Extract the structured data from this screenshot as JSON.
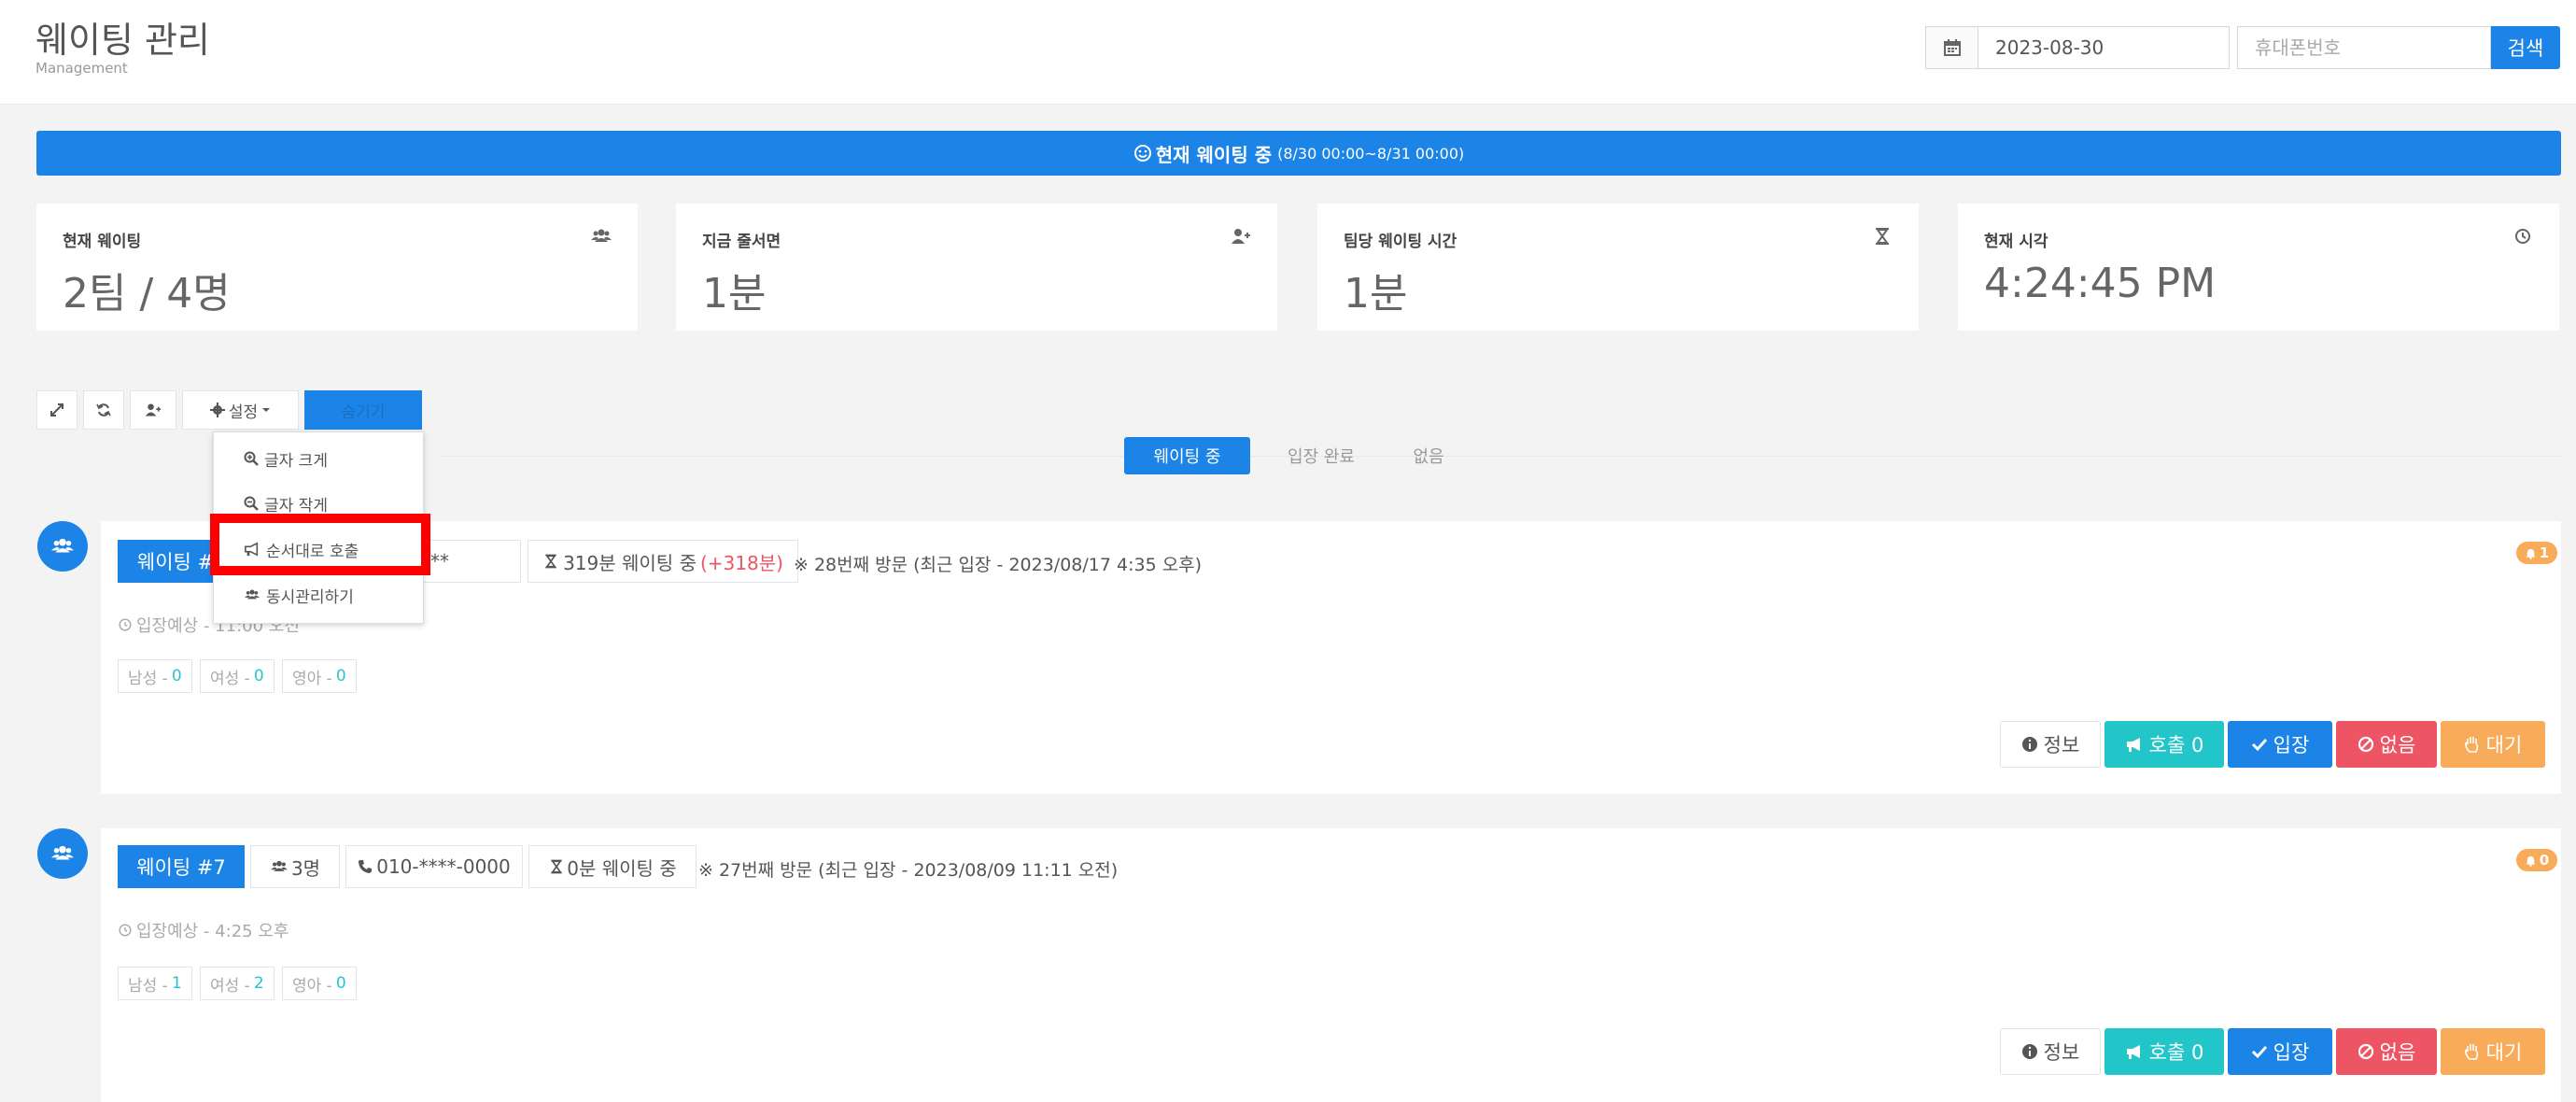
{
  "header": {
    "title": "웨이팅 관리",
    "subtitle": "Management",
    "date": "2023-08-30",
    "phone_placeholder": "휴대폰번호",
    "search_label": "검색"
  },
  "banner": {
    "text": "현재 웨이팅 중",
    "range": "(8/30 00:00~8/31 00:00)"
  },
  "stats": [
    {
      "label": "현재 웨이팅",
      "value": "2팀 / 4명",
      "icon": "users-icon"
    },
    {
      "label": "지금 줄서면",
      "value": "1분",
      "icon": "user-plus-icon"
    },
    {
      "label": "팀당 웨이팅 시간",
      "value": "1분",
      "icon": "hourglass-icon"
    },
    {
      "label": "현재 시각",
      "value": "4:24:45 PM",
      "icon": "clock-icon"
    }
  ],
  "toolbar": {
    "settings_label": "설정",
    "hidden_label": "숨기기"
  },
  "tabs": [
    {
      "label": "웨이팅 중",
      "active": true
    },
    {
      "label": "입장 완료",
      "active": false
    },
    {
      "label": "없음",
      "active": false
    }
  ],
  "dropdown": {
    "items": [
      {
        "label": "글자 크게",
        "icon": "zoom-in-icon"
      },
      {
        "label": "글자 작게",
        "icon": "zoom-out-icon"
      },
      {
        "label": "순서대로 호출",
        "icon": "bullhorn-icon"
      },
      {
        "label": "동시관리하기",
        "icon": "users-icon"
      }
    ]
  },
  "cards": [
    {
      "number": "웨이팅 #",
      "phone": "**",
      "wait": "319분 웨이팅 중",
      "wait_extra": "(+318분)",
      "visit": "※ 28번째 방문 (최근 입장 - 2023/08/17 4:35 오후)",
      "eta": "입장예상 - 11:00 오전",
      "male_label": "남성 -",
      "male": "0",
      "female_label": "여성 -",
      "female": "0",
      "infant_label": "영아 -",
      "infant": "0",
      "badge": "1",
      "actions": {
        "info": "정보",
        "call": "호출 0",
        "enter": "입장",
        "none": "없음",
        "wait": "대기"
      }
    },
    {
      "number": "웨이팅 #7",
      "people": "3명",
      "phone": "010-****-0000",
      "wait": "0분 웨이팅 중",
      "visit": "※ 27번째 방문 (최근 입장 - 2023/08/09 11:11 오전)",
      "eta": "입장예상 - 4:25 오후",
      "male_label": "남성 -",
      "male": "1",
      "female_label": "여성 -",
      "female": "2",
      "infant_label": "영아 -",
      "infant": "0",
      "badge": "0",
      "actions": {
        "info": "정보",
        "call": "호출 0",
        "enter": "입장",
        "none": "없음",
        "wait": "대기"
      }
    }
  ],
  "colors": {
    "primary": "#1c84e6",
    "cyan": "#23c6c8",
    "red": "#ed5565",
    "orange": "#f8ac59",
    "highlight": "#ff0000"
  }
}
